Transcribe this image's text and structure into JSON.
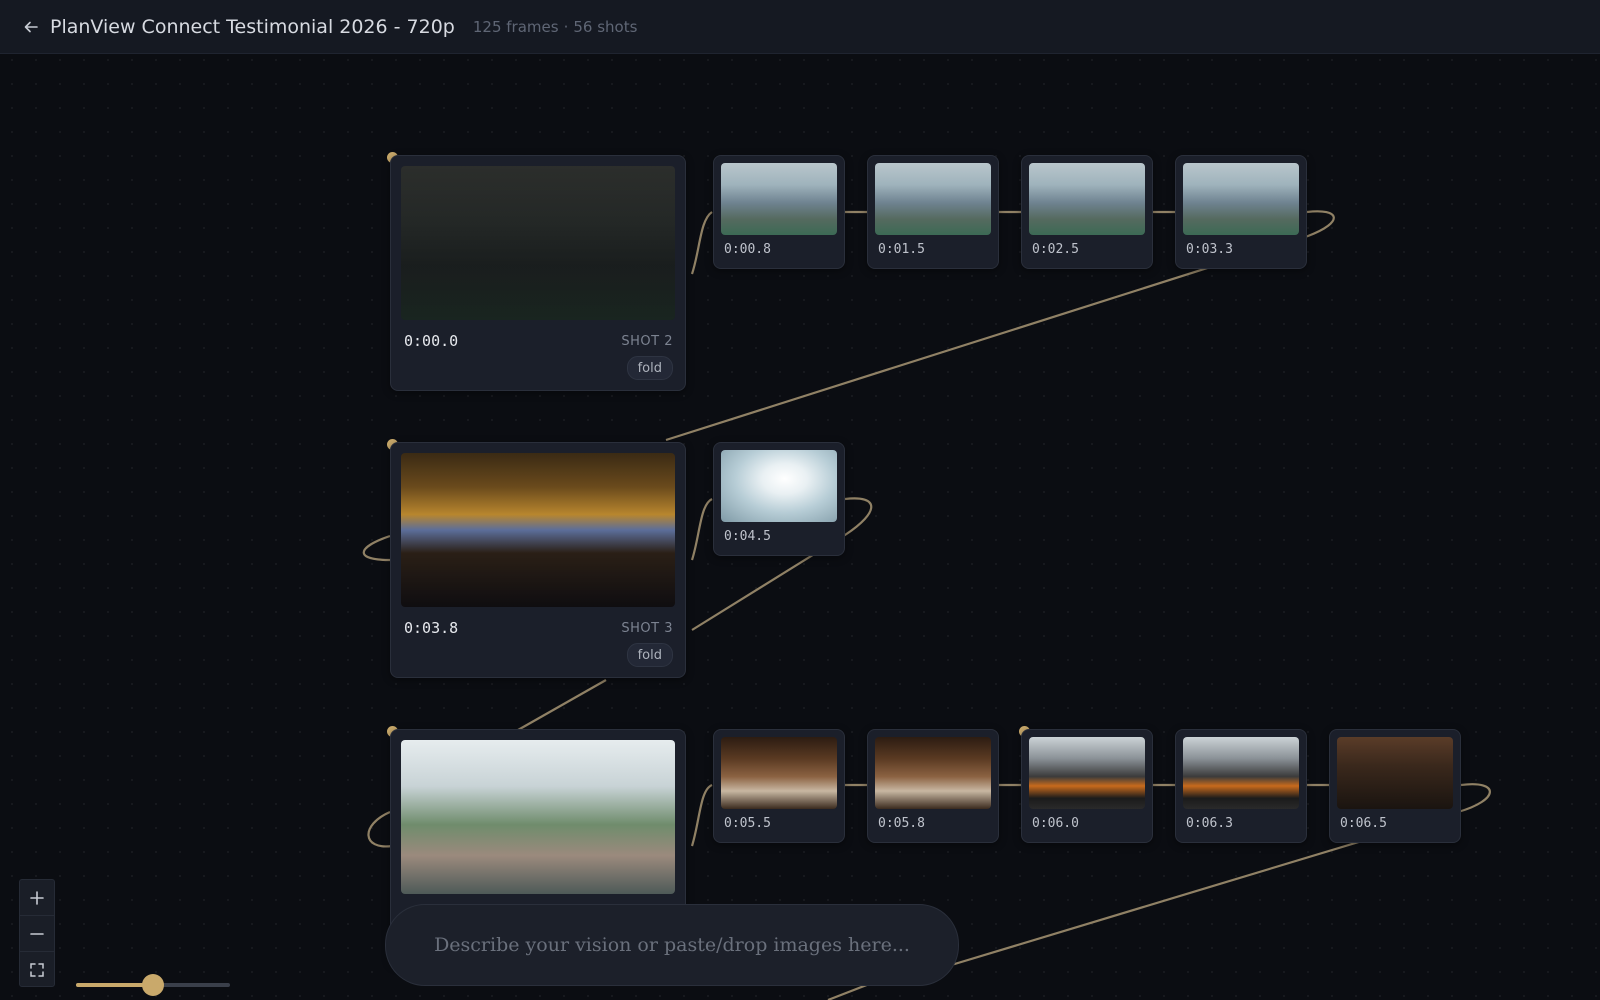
{
  "header": {
    "title": "PlanView Connect Testimonial 2026 - 720p",
    "frames": "125 frames",
    "separator": "·",
    "shots": "56 shots"
  },
  "shots": [
    {
      "label": "SHOT 2",
      "fold": "fold",
      "main": {
        "time": "0:00.0"
      },
      "frames": [
        "0:00.8",
        "0:01.5",
        "0:02.5",
        "0:03.3"
      ]
    },
    {
      "label": "SHOT 3",
      "fold": "fold",
      "main": {
        "time": "0:03.8"
      },
      "frames": [
        "0:04.5"
      ]
    },
    {
      "main": {
        "time": ""
      },
      "frames": [
        "0:05.5",
        "0:05.8",
        "0:06.0",
        "0:06.3",
        "0:06.5"
      ]
    }
  ],
  "prompt": {
    "placeholder": "Describe your vision or paste/drop images here..."
  },
  "zoom": {
    "level": 0.5
  },
  "colors": {
    "accent": "#c9a96b",
    "wire": "#a89774",
    "background": "#0b0d12"
  }
}
